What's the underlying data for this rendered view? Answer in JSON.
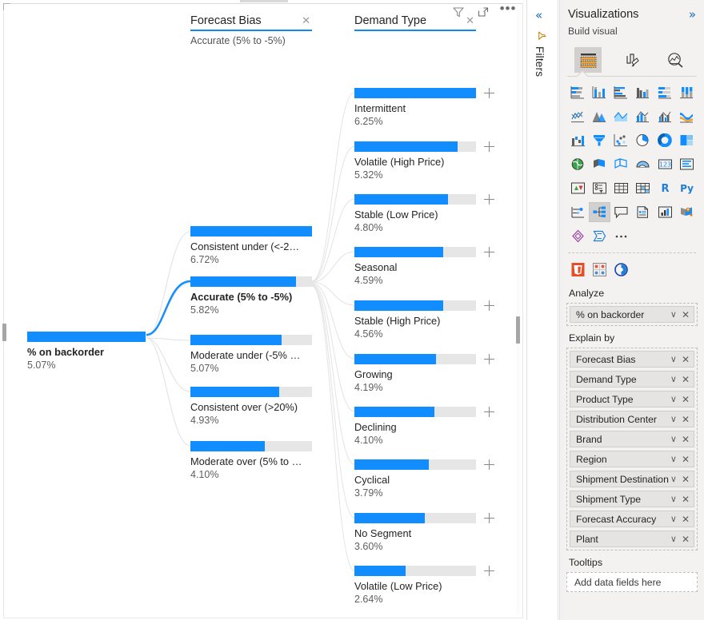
{
  "visual": {
    "toolbar": {
      "filter_icon": "funnel-icon",
      "focus_icon": "focus-mode-icon",
      "more_label": "•••"
    }
  },
  "tree": {
    "root": {
      "label": "% on backorder",
      "value": "5.07%",
      "fill_pct": 100
    },
    "columns": [
      {
        "title": "Forecast Bias",
        "subtitle": "Accurate (5% to -5%)",
        "close_label": "✕",
        "nodes": [
          {
            "label": "Consistent under (<-2…",
            "value": "6.72%",
            "fill_pct": 100,
            "selected": false,
            "expandable": false
          },
          {
            "label": "Accurate (5% to -5%)",
            "value": "5.82%",
            "fill_pct": 87,
            "selected": true,
            "expandable": false
          },
          {
            "label": "Moderate under (-5% …",
            "value": "5.07%",
            "fill_pct": 75,
            "selected": false,
            "expandable": false
          },
          {
            "label": "Consistent over (>20%)",
            "value": "4.93%",
            "fill_pct": 73,
            "selected": false,
            "expandable": false
          },
          {
            "label": "Moderate over (5% to …",
            "value": "4.10%",
            "fill_pct": 61,
            "selected": false,
            "expandable": false
          }
        ]
      },
      {
        "title": "Demand Type",
        "subtitle": "",
        "close_label": "✕",
        "nodes": [
          {
            "label": "Intermittent",
            "value": "6.25%",
            "fill_pct": 100,
            "selected": false,
            "expandable": true
          },
          {
            "label": "Volatile (High Price)",
            "value": "5.32%",
            "fill_pct": 85,
            "selected": false,
            "expandable": true
          },
          {
            "label": "Stable (Low Price)",
            "value": "4.80%",
            "fill_pct": 77,
            "selected": false,
            "expandable": true
          },
          {
            "label": "Seasonal",
            "value": "4.59%",
            "fill_pct": 73,
            "selected": false,
            "expandable": true
          },
          {
            "label": "Stable (High Price)",
            "value": "4.56%",
            "fill_pct": 73,
            "selected": false,
            "expandable": true
          },
          {
            "label": "Growing",
            "value": "4.19%",
            "fill_pct": 67,
            "selected": false,
            "expandable": true
          },
          {
            "label": "Declining",
            "value": "4.10%",
            "fill_pct": 66,
            "selected": false,
            "expandable": true
          },
          {
            "label": "Cyclical",
            "value": "3.79%",
            "fill_pct": 61,
            "selected": false,
            "expandable": true
          },
          {
            "label": "No Segment",
            "value": "3.60%",
            "fill_pct": 58,
            "selected": false,
            "expandable": true
          },
          {
            "label": "Volatile (Low Price)",
            "value": "2.64%",
            "fill_pct": 42,
            "selected": false,
            "expandable": true
          }
        ]
      }
    ]
  },
  "chart_data": {
    "type": "bar",
    "title": "Decomposition tree: % on backorder",
    "root": {
      "category": "% on backorder",
      "value": 5.07
    },
    "levels": [
      {
        "name": "Forecast Bias",
        "selected": "Accurate (5% to -5%)",
        "categories": [
          "Consistent under (<-2...",
          "Accurate (5% to -5%)",
          "Moderate under (-5% ...",
          "Consistent over (>20%)",
          "Moderate over (5% to ..."
        ],
        "values": [
          6.72,
          5.82,
          5.07,
          4.93,
          4.1
        ]
      },
      {
        "name": "Demand Type",
        "selected": null,
        "categories": [
          "Intermittent",
          "Volatile (High Price)",
          "Stable (Low Price)",
          "Seasonal",
          "Stable (High Price)",
          "Growing",
          "Declining",
          "Cyclical",
          "No Segment",
          "Volatile (Low Price)"
        ],
        "values": [
          6.25,
          5.32,
          4.8,
          4.59,
          4.56,
          4.19,
          4.1,
          3.79,
          3.6,
          2.64
        ]
      }
    ],
    "unit": "%",
    "ylabel": "% on backorder",
    "xlabel": "",
    "grid": false,
    "legend": "none",
    "accent_color": "#118dff",
    "track_color": "#e6e6e6"
  },
  "rail": {
    "collapse_label": "«",
    "filters_label": "Filters",
    "filter_icon": "filter-icon"
  },
  "visualizations": {
    "title": "Visualizations",
    "expand_label": "»",
    "subtitle": "Build visual",
    "tabs": [
      {
        "name": "build-visual-tab",
        "icon": "fields-table-icon",
        "active": true
      },
      {
        "name": "format-visual-tab",
        "icon": "paint-roller-icon",
        "active": false
      },
      {
        "name": "analytics-tab",
        "icon": "magnifier-chart-icon",
        "active": false
      }
    ],
    "gallery_rows": [
      [
        "stacked-bar-chart-icon",
        "stacked-column-chart-icon",
        "clustered-bar-chart-icon",
        "clustered-column-chart-icon",
        "hundred-stacked-bar-chart-icon",
        "hundred-stacked-column-chart-icon"
      ],
      [
        "line-chart-icon",
        "area-chart-icon",
        "stacked-area-chart-icon",
        "line-stacked-column-chart-icon",
        "line-clustered-column-chart-icon",
        "ribbon-chart-icon"
      ],
      [
        "waterfall-chart-icon",
        "funnel-chart-icon",
        "scatter-chart-icon",
        "pie-chart-icon",
        "donut-chart-icon",
        "treemap-icon"
      ],
      [
        "map-icon",
        "filled-map-icon",
        "shape-map-icon",
        "azure-map-icon",
        "card-icon",
        "multi-row-card-icon"
      ],
      [
        "kpi-icon",
        "slicer-icon",
        "table-icon",
        "matrix-icon",
        "r-script-visual-icon",
        "python-visual-icon"
      ],
      [
        "key-influencers-icon",
        "decomposition-tree-icon",
        "qna-icon",
        "smart-narrative-icon",
        "metrics-icon",
        "paginated-report-icon"
      ],
      [
        "power-apps-icon",
        "power-automate-icon",
        "more-visuals-icon"
      ]
    ],
    "custom_visuals": [
      "html-content-icon",
      "custom-matrix-icon",
      "custom-visual-icon"
    ],
    "selected_gallery_icon": "decomposition-tree-icon",
    "wells": [
      {
        "title": "Analyze",
        "fields": [
          {
            "name": "% on backorder",
            "caret": "∨",
            "remove": "✕"
          }
        ]
      },
      {
        "title": "Explain by",
        "fields": [
          {
            "name": "Forecast Bias",
            "caret": "∨",
            "remove": "✕"
          },
          {
            "name": "Demand Type",
            "caret": "∨",
            "remove": "✕"
          },
          {
            "name": "Product Type",
            "caret": "∨",
            "remove": "✕"
          },
          {
            "name": "Distribution Center",
            "caret": "∨",
            "remove": "✕"
          },
          {
            "name": "Brand",
            "caret": "∨",
            "remove": "✕"
          },
          {
            "name": "Region",
            "caret": "∨",
            "remove": "✕"
          },
          {
            "name": "Shipment Destination",
            "caret": "∨",
            "remove": "✕"
          },
          {
            "name": "Shipment Type",
            "caret": "∨",
            "remove": "✕"
          },
          {
            "name": "Forecast Accuracy",
            "caret": "∨",
            "remove": "✕"
          },
          {
            "name": "Plant",
            "caret": "∨",
            "remove": "✕"
          }
        ]
      }
    ],
    "tooltips": {
      "title": "Tooltips",
      "placeholder": "Add data fields here"
    }
  }
}
